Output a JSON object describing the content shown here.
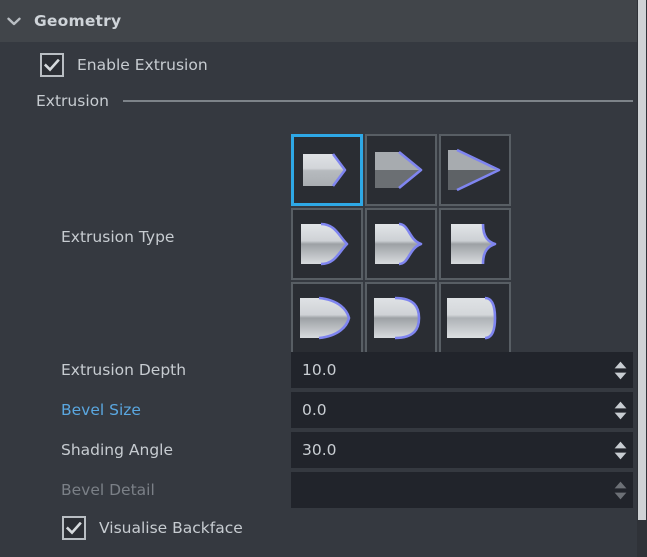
{
  "header": {
    "title": "Geometry",
    "collapse_icon": "chevron-down-icon",
    "expanded": true
  },
  "enable_extrusion": {
    "label": "Enable Extrusion",
    "checked": true,
    "check_icon": "checkmark-icon"
  },
  "extrusion_section": {
    "title": "Extrusion"
  },
  "extrusion_type": {
    "label": "Extrusion Type",
    "selected_index": 0,
    "options": [
      {
        "name": "flat-chamfer-extrusion",
        "row": 1,
        "col": 1
      },
      {
        "name": "straight-taper-extrusion",
        "row": 1,
        "col": 2
      },
      {
        "name": "sharp-point-extrusion",
        "row": 1,
        "col": 3
      },
      {
        "name": "concave-taper-extrusion",
        "row": 2,
        "col": 1
      },
      {
        "name": "concave-point-extrusion",
        "row": 2,
        "col": 2
      },
      {
        "name": "inward-notch-extrusion",
        "row": 2,
        "col": 3
      },
      {
        "name": "convex-point-extrusion",
        "row": 3,
        "col": 1
      },
      {
        "name": "round-bulge-extrusion",
        "row": 3,
        "col": 2
      },
      {
        "name": "rounded-cap-extrusion",
        "row": 3,
        "col": 3
      }
    ]
  },
  "properties": [
    {
      "label": "Extrusion Depth",
      "value": "10.0",
      "state": "normal",
      "has_spinner": true
    },
    {
      "label": "Bevel Size",
      "value": "0.0",
      "state": "animated",
      "has_spinner": true
    },
    {
      "label": "Shading Angle",
      "value": "30.0",
      "state": "normal",
      "has_spinner": true
    },
    {
      "label": "Bevel Detail",
      "value": "",
      "state": "disabled",
      "has_spinner": true
    }
  ],
  "visualise_backface": {
    "label": "Visualise Backface",
    "checked": true,
    "check_icon": "checkmark-icon"
  },
  "colors": {
    "panel_background": "#353940",
    "header_background": "#41454a",
    "field_background": "#21242b",
    "text": "#c7ccd1",
    "animated_label": "#5aa7e0",
    "disabled_label": "#7b8087",
    "selection_border": "#2ea8e6",
    "icon_outline": "#7f85f0",
    "cell_border": "#585e64",
    "scrollbar_thumb": "#cfd2d5"
  }
}
